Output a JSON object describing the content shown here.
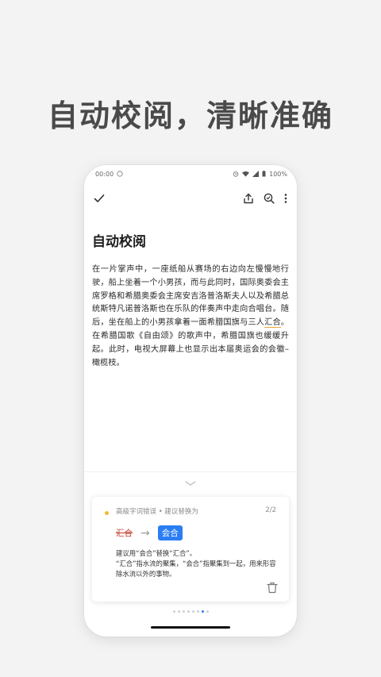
{
  "headline": "自动校阅，清晰准确",
  "status_bar": {
    "time": "00:00",
    "battery": "100%"
  },
  "toolbar": {
    "icons": [
      "check-icon",
      "share-icon",
      "search-icon",
      "more-icon"
    ]
  },
  "document": {
    "title": "自动校阅",
    "body_before": "在一片掌声中，一座纸船从赛场的右边向左慢慢地行驶，船上坐着一个小男孩，而与此同时，国际奥委会主席罗格和希腊奥委会主席安吉洛普洛斯夫人以及希腊总统斯特凡诺普洛斯也在乐队的伴奏声中走向合唱台。随后，坐在船上的小男孩拿着一面希腊国旗与三人",
    "body_error": "汇合",
    "body_after": "。在希腊国歌《自由颂》的歌声中，希腊国旗也缓缓升起。此时，电视大屏幕上也显示出本届奥运会的会徽–橄榄枝。"
  },
  "suggestion": {
    "category": "高级字词错误 • 建议替换为",
    "counter": "2/2",
    "old_word": "汇合",
    "new_word": "会合",
    "note_line1": "建议用“会合”替换“汇合”。",
    "note_line2": "“汇合”指水流的聚集，“会合”指聚集到一起，用来形容除水流以外的事物。"
  },
  "pagination": {
    "total": 8,
    "active_index": 6
  },
  "colors": {
    "accent": "#2b7df3",
    "error_underline": "#f2a23a",
    "warning_dot": "#f7b731",
    "strike": "#c0392b"
  }
}
